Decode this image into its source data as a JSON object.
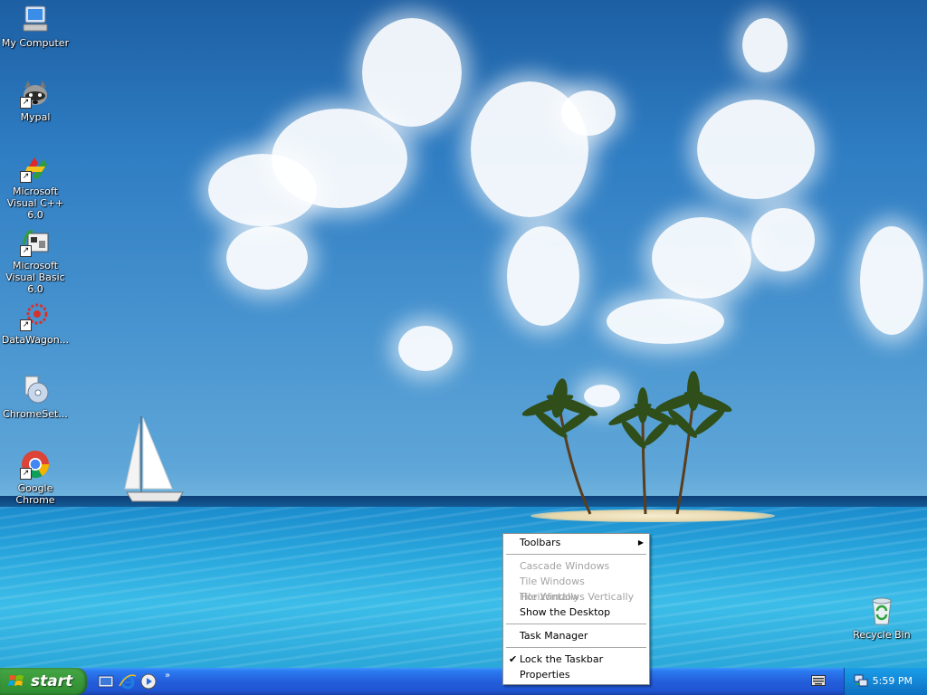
{
  "desktop_icons": [
    {
      "label": "My Computer",
      "icon": "my-computer-icon",
      "shortcut": false
    },
    {
      "label": "Mypal",
      "icon": "mypal-raccoon-icon",
      "shortcut": true
    },
    {
      "label": "Microsoft Visual C++ 6.0",
      "icon": "visual-cpp-icon",
      "shortcut": true
    },
    {
      "label": "Microsoft Visual Basic 6.0",
      "icon": "visual-basic-icon",
      "shortcut": true
    },
    {
      "label": "DataWagon...",
      "icon": "datawagon-icon",
      "shortcut": true
    },
    {
      "label": "ChromeSet...",
      "icon": "chrome-setup-icon",
      "shortcut": false
    },
    {
      "label": "Google Chrome",
      "icon": "google-chrome-icon",
      "shortcut": true
    },
    {
      "label": "Recycle Bin",
      "icon": "recycle-bin-icon",
      "shortcut": false
    }
  ],
  "taskbar": {
    "start_label": "start",
    "quick_launch": [
      "show-desktop-icon",
      "internet-explorer-icon",
      "media-player-icon"
    ],
    "more_label": "»",
    "clock": "5:59 PM",
    "colors": {
      "bar": "#245edb",
      "start": "#3c9a3c",
      "tray": "#1487d6"
    }
  },
  "context_menu": {
    "items": [
      {
        "label": "Toolbars",
        "enabled": true,
        "submenu": true
      },
      {
        "label": "Cascade Windows",
        "enabled": false
      },
      {
        "label": "Tile Windows Horizontally",
        "enabled": false
      },
      {
        "label": "Tile Windows Vertically",
        "enabled": false
      },
      {
        "label": "Show the Desktop",
        "enabled": true
      },
      {
        "label": "Task Manager",
        "enabled": true
      },
      {
        "label": "Lock the Taskbar",
        "enabled": true,
        "checked": true
      },
      {
        "label": "Properties",
        "enabled": true
      }
    ],
    "submenu_arrow": "▶",
    "check_mark": "✔"
  }
}
